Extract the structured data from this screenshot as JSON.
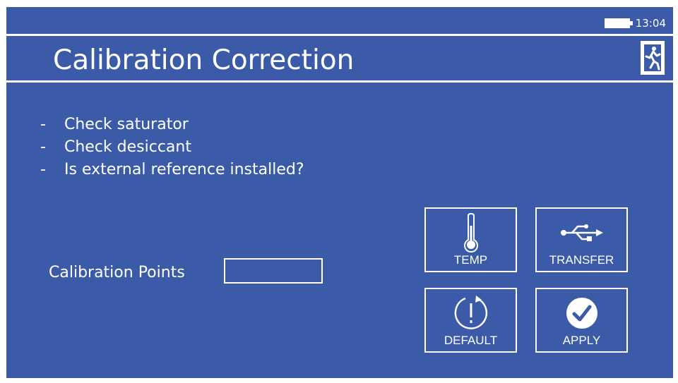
{
  "status": {
    "time": "13:04",
    "battery_icon": "battery-icon"
  },
  "header": {
    "title": "Calibration Correction",
    "exit_icon": "exit-icon"
  },
  "checklist": [
    {
      "dash": "-",
      "text": "Check saturator"
    },
    {
      "dash": "-",
      "text": "Check desiccant"
    },
    {
      "dash": "-",
      "text": "Is external reference installed?"
    }
  ],
  "calibration_points": {
    "label": "Calibration Points",
    "value": ""
  },
  "buttons": {
    "temp": {
      "label": "TEMP",
      "icon": "thermometer-icon"
    },
    "transfer": {
      "label": "TRANSFER",
      "icon": "usb-icon"
    },
    "default": {
      "label": "DEFAULT",
      "icon": "reset-icon"
    },
    "apply": {
      "label": "APPLY",
      "icon": "checkmark-icon"
    }
  },
  "colors": {
    "background": "#3b5ba8",
    "foreground": "#ffffff"
  }
}
